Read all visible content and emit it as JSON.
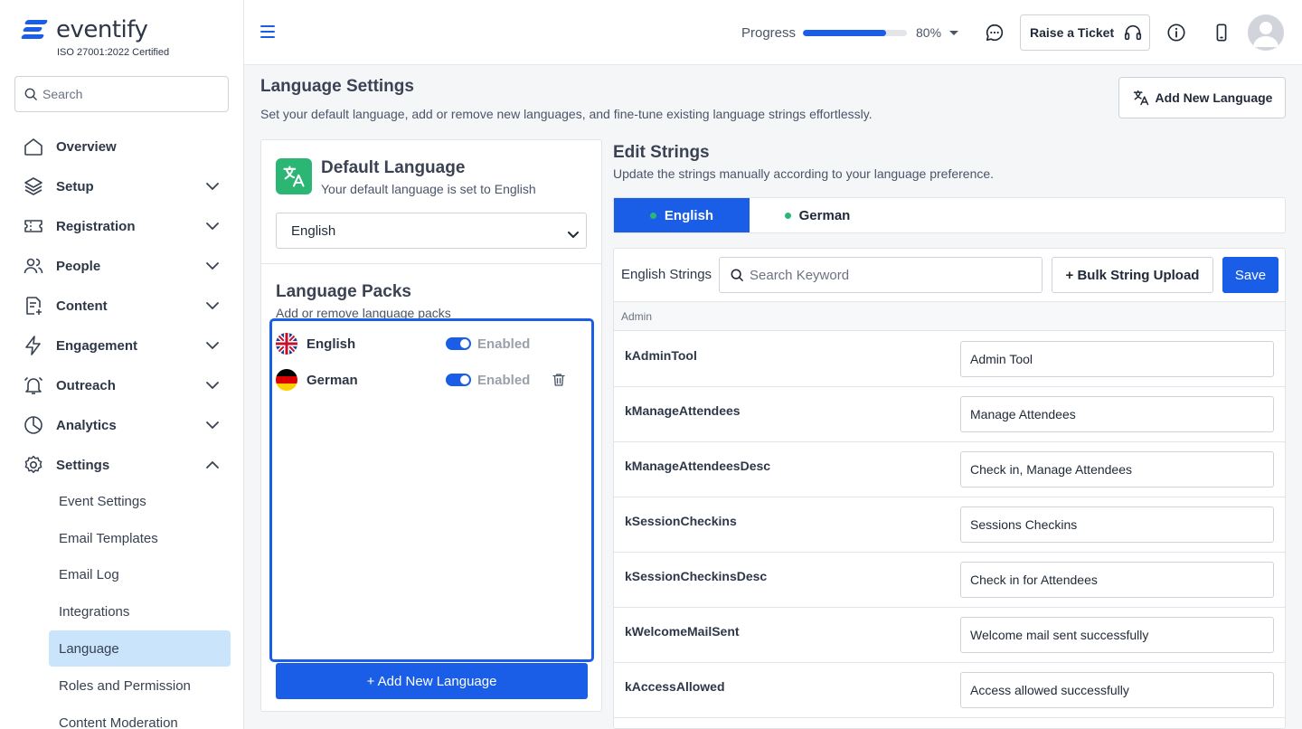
{
  "brand": {
    "name": "eventify",
    "certification": "ISO 27001:2022 Certified",
    "color": "#1a5ee8"
  },
  "sidebar": {
    "search_placeholder": "Search",
    "nav": [
      {
        "label": "Overview",
        "icon": "home-icon",
        "expandable": false
      },
      {
        "label": "Setup",
        "icon": "layers-icon",
        "expandable": true,
        "expanded": false
      },
      {
        "label": "Registration",
        "icon": "ticket-icon",
        "expandable": true,
        "expanded": false
      },
      {
        "label": "People",
        "icon": "people-icon",
        "expandable": true,
        "expanded": false
      },
      {
        "label": "Content",
        "icon": "content-icon",
        "expandable": true,
        "expanded": false
      },
      {
        "label": "Engagement",
        "icon": "lightning-icon",
        "expandable": true,
        "expanded": false
      },
      {
        "label": "Outreach",
        "icon": "bell-icon",
        "expandable": true,
        "expanded": false
      },
      {
        "label": "Analytics",
        "icon": "pie-chart-icon",
        "expandable": true,
        "expanded": false
      },
      {
        "label": "Settings",
        "icon": "gear-icon",
        "expandable": true,
        "expanded": true
      }
    ],
    "settings_sub": [
      {
        "label": "Event Settings",
        "active": false
      },
      {
        "label": "Email Templates",
        "active": false
      },
      {
        "label": "Email Log",
        "active": false
      },
      {
        "label": "Integrations",
        "active": false
      },
      {
        "label": "Language",
        "active": true
      },
      {
        "label": "Roles and Permission",
        "active": false
      },
      {
        "label": "Content Moderation",
        "active": false
      }
    ]
  },
  "topbar": {
    "progress_label": "Progress",
    "progress_value": 80,
    "progress_text": "80%",
    "ticket_label": "Raise a Ticket"
  },
  "page": {
    "title": "Language Settings",
    "description": "Set your default language, add or remove new languages, and fine-tune existing language strings effortlessly.",
    "add_language_label": "Add New Language"
  },
  "default_language": {
    "title": "Default Language",
    "subtitle": "Your default language is set to English",
    "selected": "English",
    "accent": "#2cb673"
  },
  "language_packs": {
    "title": "Language Packs",
    "subtitle": "Add or remove language packs",
    "items": [
      {
        "name": "English",
        "flag": "uk-flag-icon",
        "status": "Enabled",
        "enabled": true,
        "deletable": false
      },
      {
        "name": "German",
        "flag": "germany-flag-icon",
        "status": "Enabled",
        "enabled": true,
        "deletable": true
      }
    ],
    "add_label": "+ Add New Language"
  },
  "edit_strings": {
    "title": "Edit Strings",
    "subtitle": "Update the strings manually according to your language preference.",
    "tabs": [
      {
        "label": "English",
        "active": true
      },
      {
        "label": "German",
        "active": false
      }
    ],
    "panel_label": "English Strings",
    "search_placeholder": "Search Keyword",
    "bulk_label": "+ Bulk String Upload",
    "save_label": "Save",
    "group": "Admin",
    "rows": [
      {
        "key": "kAdminTool",
        "value": "Admin Tool"
      },
      {
        "key": "kManageAttendees",
        "value": "Manage Attendees"
      },
      {
        "key": "kManageAttendeesDesc",
        "value": "Check in, Manage Attendees"
      },
      {
        "key": "kSessionCheckins",
        "value": "Sessions Checkins"
      },
      {
        "key": "kSessionCheckinsDesc",
        "value": "Check in for Attendees"
      },
      {
        "key": "kWelcomeMailSent",
        "value": "Welcome mail sent successfully"
      },
      {
        "key": "kAccessAllowed",
        "value": "Access allowed successfully"
      }
    ]
  }
}
